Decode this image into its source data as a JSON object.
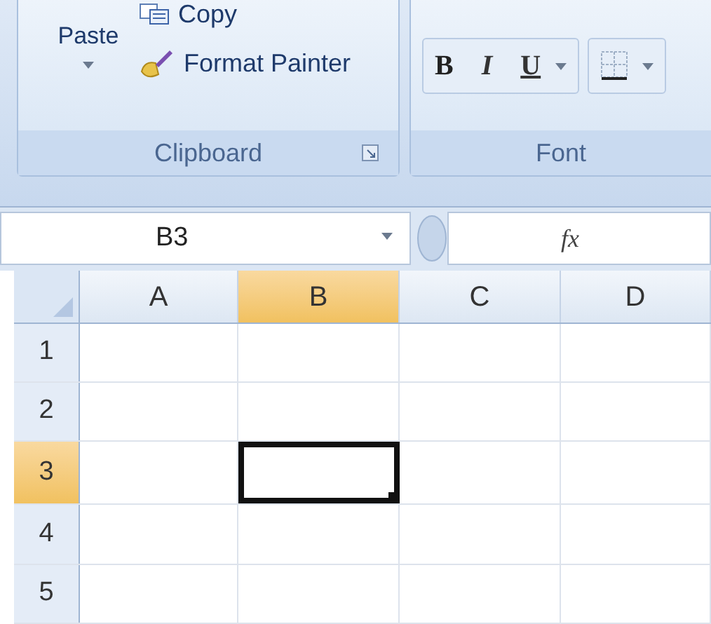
{
  "ribbon": {
    "groups": [
      {
        "kind": "clipboard",
        "label": "Clipboard",
        "paste": "Paste",
        "copy": "Copy",
        "format_painter": "Format Painter"
      },
      {
        "kind": "font",
        "label": "Font",
        "bold": "B",
        "italic": "I",
        "underline": "U"
      }
    ]
  },
  "formula_bar": {
    "name_box": "B3",
    "fx": "fx"
  },
  "sheet": {
    "columns": [
      {
        "label": "A",
        "selected": false
      },
      {
        "label": "B",
        "selected": true
      },
      {
        "label": "C",
        "selected": false
      },
      {
        "label": "D",
        "selected": false
      }
    ],
    "rows": [
      {
        "label": "1",
        "selected": false,
        "cells": [
          {
            "selected": false
          },
          {
            "selected": false
          },
          {
            "selected": false
          },
          {
            "selected": false
          }
        ]
      },
      {
        "label": "2",
        "selected": false,
        "cells": [
          {
            "selected": false
          },
          {
            "selected": false
          },
          {
            "selected": false
          },
          {
            "selected": false
          }
        ]
      },
      {
        "label": "3",
        "selected": true,
        "cells": [
          {
            "selected": false
          },
          {
            "selected": true
          },
          {
            "selected": false
          },
          {
            "selected": false
          }
        ]
      },
      {
        "label": "4",
        "selected": false,
        "cells": [
          {
            "selected": false
          },
          {
            "selected": false
          },
          {
            "selected": false
          },
          {
            "selected": false
          }
        ]
      },
      {
        "label": "5",
        "selected": false,
        "cells": [
          {
            "selected": false
          },
          {
            "selected": false
          },
          {
            "selected": false
          },
          {
            "selected": false
          }
        ]
      }
    ]
  }
}
